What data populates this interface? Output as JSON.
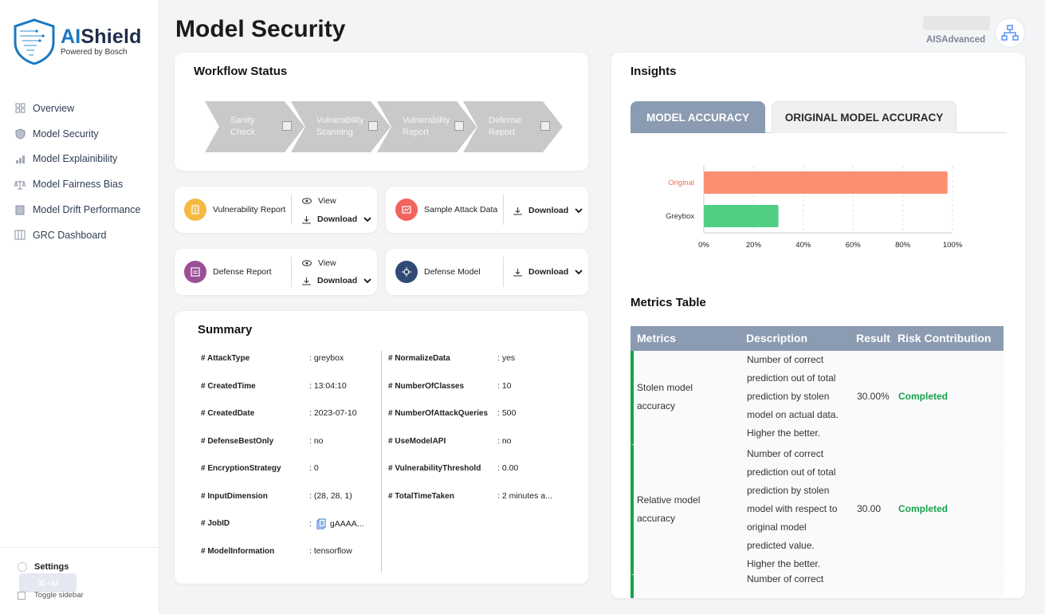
{
  "brand": {
    "name_ai": "AI",
    "name_rest": "Shield",
    "tagline": "Powered by Bosch"
  },
  "sidebar": {
    "items": [
      {
        "label": "Overview",
        "icon": "grid-icon"
      },
      {
        "label": "Model Security",
        "icon": "shield-icon"
      },
      {
        "label": "Model Explainibility",
        "icon": "bar-chart-icon"
      },
      {
        "label": "Model Fairness Bias",
        "icon": "scale-icon"
      },
      {
        "label": "Model Drift Performance",
        "icon": "document-icon"
      },
      {
        "label": "GRC Dashboard",
        "icon": "columns-icon"
      }
    ],
    "settings_label": "Settings",
    "shortcut": "⌘+M",
    "toggle_label": "Toggle sidebar"
  },
  "page": {
    "title": "Model Security"
  },
  "user": {
    "name": "AISAdvanced",
    "icon": "sitemap-icon"
  },
  "workflow": {
    "title": "Workflow Status",
    "steps": [
      {
        "line1": "Sanity",
        "line2": "Check"
      },
      {
        "line1": "Vulnerability",
        "line2": "Scanning"
      },
      {
        "line1": "Vulnerability",
        "line2": "Report"
      },
      {
        "line1": "Defense",
        "line2": "Report"
      }
    ]
  },
  "artifacts": {
    "vulnerability_report": {
      "title": "Vulnerability Report",
      "view": "View",
      "download": "Download",
      "color": "#f5b942"
    },
    "sample_attack": {
      "title": "Sample Attack Data",
      "download": "Download",
      "color": "#f0645c"
    },
    "defense_report": {
      "title": "Defense Report",
      "view": "View",
      "download": "Download",
      "color": "#9b4f97"
    },
    "defense_model": {
      "title": "Defense Model",
      "download": "Download",
      "color": "#2f4a73"
    }
  },
  "summary": {
    "title": "Summary",
    "left": [
      {
        "key": "# AttackType",
        "value": ": greybox"
      },
      {
        "key": "# CreatedTime",
        "value": ": 13:04:10"
      },
      {
        "key": "# CreatedDate",
        "value": ": 2023-07-10"
      },
      {
        "key": "# DefenseBestOnly",
        "value": ": no"
      },
      {
        "key": "# EncryptionStrategy",
        "value": ": 0"
      },
      {
        "key": "# InputDimension",
        "value": ": (28, 28, 1)"
      },
      {
        "key": "# JobID",
        "value": "gAAAA..."
      },
      {
        "key": "# ModelInformation",
        "value": ": tensorflow"
      }
    ],
    "jobid_prefix": ":",
    "right": [
      {
        "key": "# NormalizeData",
        "value": ": yes"
      },
      {
        "key": "# NumberOfClasses",
        "value": ": 10"
      },
      {
        "key": "# NumberOfAttackQueries",
        "value": ": 500"
      },
      {
        "key": "# UseModelAPI",
        "value": ": no"
      },
      {
        "key": "# VulnerabilityThreshold",
        "value": ": 0.00"
      },
      {
        "key": "# TotalTimeTaken",
        "value": ": 2 minutes a..."
      }
    ]
  },
  "insights": {
    "title": "Insights",
    "tabs": [
      "MODEL ACCURACY",
      "ORIGINAL MODEL ACCURACY"
    ],
    "metrics_title": "Metrics Table",
    "table": {
      "headers": [
        "Metrics",
        "Description",
        "Result",
        "Risk Contribution"
      ],
      "rows": [
        {
          "metric": [
            "Stolen model",
            "accuracy"
          ],
          "desc": [
            "Number of correct",
            "prediction out of total",
            "prediction by stolen",
            "model on actual data.",
            "Higher the better."
          ],
          "result": "30.00%",
          "risk": "Completed"
        },
        {
          "metric": [
            "Relative model",
            "accuracy"
          ],
          "desc": [
            "Number of correct",
            "prediction out of total",
            "prediction by stolen",
            "model with respect to",
            "original model",
            "predicted value.",
            "Higher the better."
          ],
          "result": "30.00",
          "risk": "Completed"
        }
      ],
      "partial_text": "Number of correct"
    }
  },
  "chart_data": {
    "type": "bar",
    "orientation": "horizontal",
    "categories": [
      "Original",
      "Greybox"
    ],
    "values": [
      98,
      30
    ],
    "colors": [
      "#fc8f72",
      "#50cf84"
    ],
    "xlim": [
      0,
      100
    ],
    "xticks": [
      "0%",
      "20%",
      "40%",
      "60%",
      "80%",
      "100%"
    ],
    "grid": "vertical dashed"
  }
}
